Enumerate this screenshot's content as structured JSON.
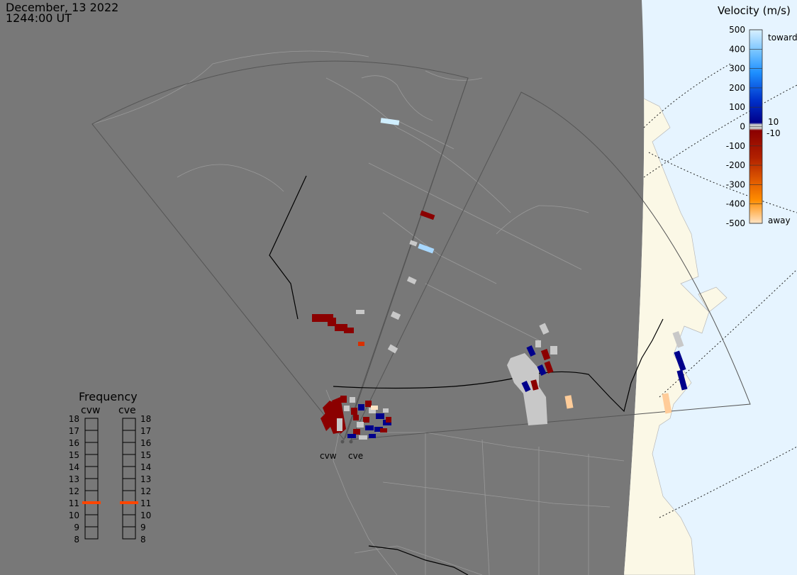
{
  "header": {
    "date": "December, 13 2022",
    "time": "1244:00 UT"
  },
  "velocity_scale": {
    "title": "Velocity (m/s)",
    "ticks": [
      "500",
      "400",
      "300",
      "200",
      "100",
      "0",
      "-100",
      "-200",
      "-300",
      "-400",
      "-500"
    ],
    "inner_labels": [
      "10",
      "-10"
    ],
    "end_labels": {
      "toward": "toward",
      "away": "away"
    },
    "colors": {
      "toward_max": "#cfeeff",
      "toward_mid": "#1e90ff",
      "toward_min": "#00008b",
      "near_zero": "#c8c8c8",
      "away_min": "#8b0000",
      "away_mid": "#ff8c00",
      "away_max": "#ffe4c4"
    }
  },
  "frequency_panel": {
    "title": "Frequency",
    "radars": [
      "cvw",
      "cve"
    ],
    "mhz_labels": [
      "18",
      "17",
      "16",
      "15",
      "14",
      "13",
      "12",
      "11",
      "10",
      "9",
      "8"
    ],
    "active_mhz": {
      "cvw": 11,
      "cve": 11
    },
    "active_color": "#ff4500"
  },
  "radar_sites": {
    "cvw": "cvw",
    "cve": "cve"
  },
  "map_colors": {
    "night_side": "#787878",
    "ocean_day": "#e6f4ff",
    "land_day": "#fbf8e6",
    "boundary": "#9a9a9a",
    "fov_outline": "#555555",
    "near_zero_echo": "#c8c8c8",
    "negative_echo": "#8b0000",
    "positive_echo": "#00008b",
    "fast_toward": "#cfeeff",
    "fast_away": "#ffcc99"
  }
}
